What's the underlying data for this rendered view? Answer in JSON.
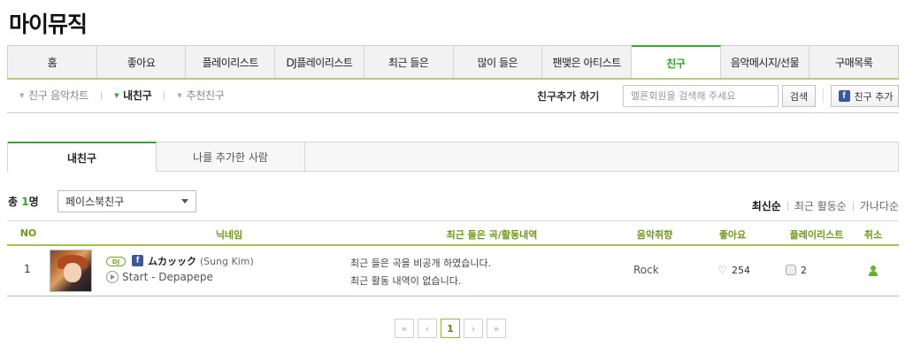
{
  "page_title": "마이뮤직",
  "tabs": [
    {
      "label": "홈",
      "active": false
    },
    {
      "label": "좋아요",
      "active": false
    },
    {
      "label": "플레이리스트",
      "active": false
    },
    {
      "label": "DJ플레이리스트",
      "active": false
    },
    {
      "label": "최근 들은",
      "active": false
    },
    {
      "label": "많이 들은",
      "active": false
    },
    {
      "label": "팬맺은 아티스트",
      "active": false
    },
    {
      "label": "친구",
      "active": true
    },
    {
      "label": "음악메시지/선물",
      "active": false
    },
    {
      "label": "구매목록",
      "active": false
    }
  ],
  "subnav": {
    "items": [
      {
        "label": "친구 음악차트",
        "active": false
      },
      {
        "label": "내친구",
        "active": true
      },
      {
        "label": "추천친구",
        "active": false
      }
    ]
  },
  "friend_search": {
    "label": "친구추가 하기",
    "placeholder": "멜론회원을 검색해 주세요",
    "search_button": "검색",
    "fb_button": "친구 추가",
    "fb_icon": "f"
  },
  "subtabs": [
    {
      "label": "내친구",
      "active": true
    },
    {
      "label": "나를 추가한 사람",
      "active": false
    }
  ],
  "total": {
    "prefix": "총 ",
    "count": "1",
    "suffix": "명"
  },
  "filter": {
    "selected": "페이스북친구"
  },
  "sort": {
    "items": [
      "최신순",
      "최근 활동순",
      "가나다순"
    ],
    "active": "최신순"
  },
  "table": {
    "headers": [
      "NO",
      "닉네임",
      "최근 들은 곡/활동내역",
      "음악취향",
      "좋아요",
      "플레이리스트",
      "취소"
    ],
    "rows": [
      {
        "no": "1",
        "dj_badge": "DJ",
        "fb_icon": "f",
        "nickname": "ムカッック",
        "real_name": "(Sung Kim)",
        "song": "Start - Depapepe",
        "recent_1": "최근 들은 곡을 비공개 하였습니다.",
        "recent_2": "최근 활동 내역이 없습니다.",
        "genre": "Rock",
        "heart_icon": "♡",
        "likes": "254",
        "playlists": "2"
      }
    ]
  },
  "pagination": {
    "first": "«",
    "prev": "‹",
    "current": "1",
    "next": "›",
    "last": "»"
  },
  "colors": {
    "accent": "#35a82a",
    "header_text": "#6c9a18",
    "facebook": "#3b5998"
  }
}
